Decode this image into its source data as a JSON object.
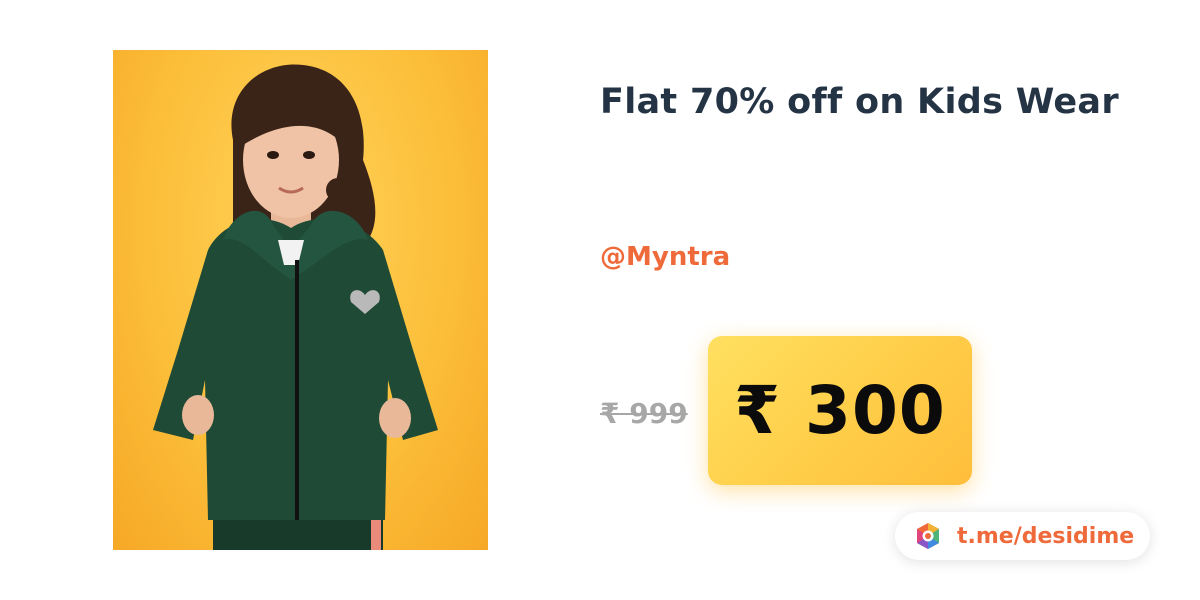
{
  "deal": {
    "title": "Flat 70% off on Kids Wear",
    "store": "@Myntra",
    "original_price": "₹ 999",
    "deal_price": "₹ 300"
  },
  "footer": {
    "telegram_link": "t.me/desidime"
  },
  "colors": {
    "title": "#253445",
    "store": "#ef6a3a",
    "price_card": "#ffcf4a",
    "image_background": "#fcbf3a",
    "jacket": "#1f4a36"
  },
  "icons": {
    "telegram_logo": "desidime-logo-icon"
  }
}
